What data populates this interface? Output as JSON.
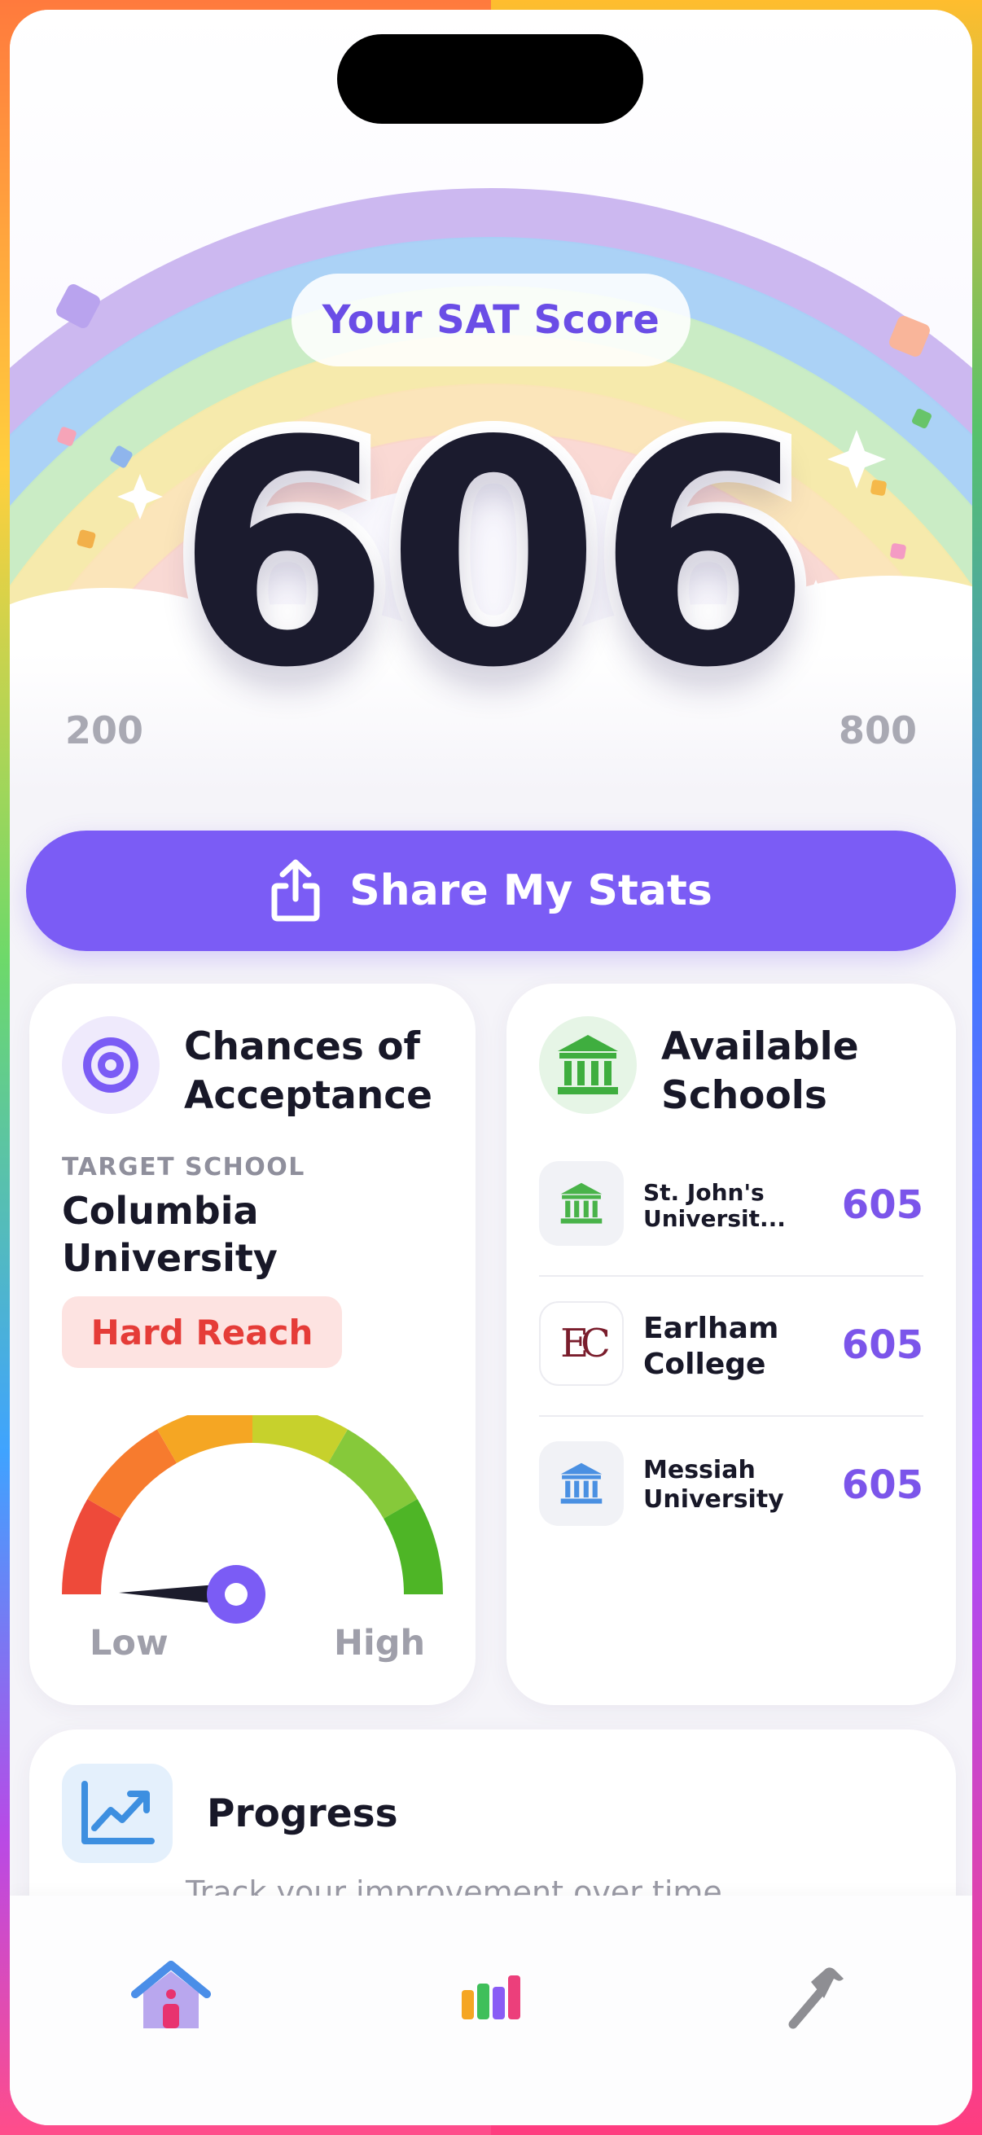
{
  "hero": {
    "title": "Your SAT Score",
    "score": "606",
    "min_label": "200",
    "max_label": "800"
  },
  "share_button": {
    "label": "Share My Stats",
    "icon": "share-icon"
  },
  "chances_card": {
    "title_line1": "Chances of",
    "title_line2": "Acceptance",
    "icon": "target-icon",
    "target_label": "TARGET SCHOOL",
    "school_line1": "Columbia",
    "school_line2": "University",
    "badge": "Hard Reach",
    "gauge_low": "Low",
    "gauge_high": "High",
    "colors": {
      "badge_bg": "#fde3e1",
      "badge_text": "#e53c38"
    }
  },
  "schools_card": {
    "title_line1": "Available",
    "title_line2": "Schools",
    "icon": "institution-icon",
    "schools": [
      {
        "name_line1": "St. John's",
        "name_line2": "Universit...",
        "score": "605",
        "logo": "institution-icon"
      },
      {
        "name_line1": "Earlham",
        "name_line2": "College",
        "score": "605",
        "logo_text": "EC"
      },
      {
        "name_line1": "Messiah",
        "name_line2": "University",
        "score": "605",
        "logo": "institution-icon"
      }
    ]
  },
  "progress_card": {
    "title": "Progress",
    "subtitle": "Track your improvement over time",
    "icon": "trend-up-icon"
  },
  "nav": {
    "items": [
      {
        "name": "home",
        "icon": "home-icon"
      },
      {
        "name": "stats",
        "icon": "bar-chart-icon"
      },
      {
        "name": "tools",
        "icon": "hammer-icon"
      }
    ]
  },
  "colors": {
    "accent": "#7b5cf5",
    "score_text": "#1b1b2e",
    "green": "#3fae3f",
    "blue": "#4a90e2"
  }
}
